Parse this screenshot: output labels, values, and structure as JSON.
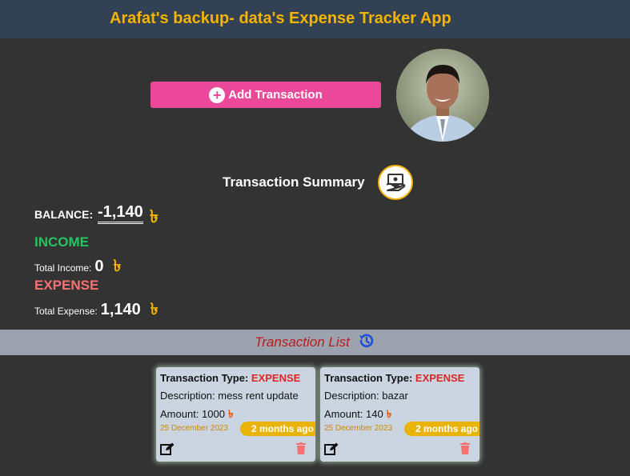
{
  "header": {
    "title": "Arafat's backup- data's Expense Tracker App"
  },
  "actions": {
    "add_transaction_label": "Add Transaction",
    "add_icon": "plus-circle-icon"
  },
  "summary": {
    "title": "Transaction Summary",
    "icon": "money-hand-icon",
    "balance_label": "BALANCE:",
    "balance_value": "-1,140",
    "currency_symbol": "৳",
    "income_heading": "INCOME",
    "total_income_label": "Total Income:",
    "total_income_value": "0",
    "expense_heading": "EXPENSE",
    "total_expense_label": "Total Expense:",
    "total_expense_value": "1,140"
  },
  "list": {
    "title": "Transaction List",
    "icon": "history-icon"
  },
  "transactions": [
    {
      "type_label": "Transaction Type:",
      "type": "EXPENSE",
      "description": "Description: mess rent update",
      "amount": "Amount: 1000",
      "date": "25 December 2023",
      "ago": "2 months ago"
    },
    {
      "type_label": "Transaction Type:",
      "type": "EXPENSE",
      "description": "Description: bazar",
      "amount": "Amount: 140",
      "date": "25 December 2023",
      "ago": "2 months ago"
    }
  ],
  "colors": {
    "header_bg": "#334155",
    "title": "#f4b400",
    "add_button": "#ec4899",
    "income": "#22c55e",
    "expense": "#f87171",
    "list_title": "#b91c1c"
  }
}
